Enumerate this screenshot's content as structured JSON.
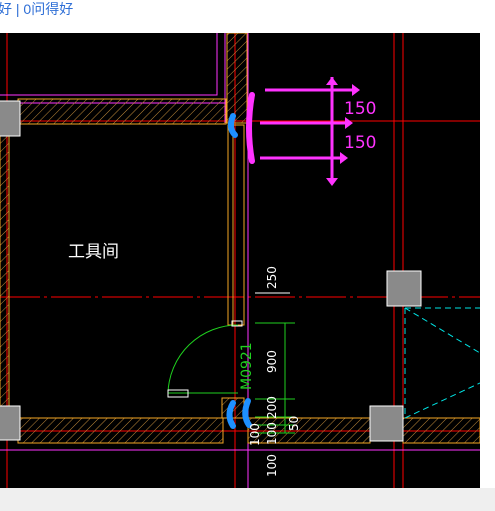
{
  "topbar": {
    "left_text": "好",
    "separator": "|",
    "right_text": "0问得好"
  },
  "drawing": {
    "room_label": "工具间",
    "door_label": "M0921",
    "annotations": [
      "150",
      "150"
    ],
    "dimensions_vertical": [
      "250",
      "900",
      "200",
      "100",
      "100",
      "50",
      "100"
    ]
  },
  "colors": {
    "background": "#000000",
    "wall": "#f5a623",
    "magenta": "#ff33ff",
    "axis_red": "#ff0000",
    "green_dim": "#1fd11f",
    "blue_mark": "#1e90ff",
    "cyan": "#00e5e5",
    "column_gray": "#8a8a8a"
  }
}
